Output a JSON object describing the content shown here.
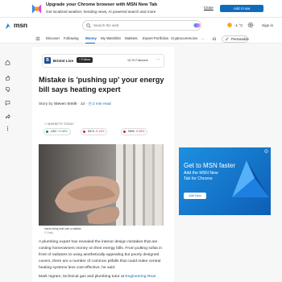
{
  "promo": {
    "title": "Upgrade your Chrome browser with MSN New Tab",
    "subtitle": "Get localized weather, trending news, AI powered search and more",
    "close_label": "Close",
    "add_label": "Add it now"
  },
  "header": {
    "logo_text": "msn",
    "search_placeholder": "Search the web",
    "weather_temp": "-1 °C",
    "signin_label": "Sign in"
  },
  "nav": {
    "items": [
      "Discover",
      "Following",
      "Money",
      "My Watchlist",
      "Markets",
      "Expert Portfolios",
      "Cryptocurrencies"
    ],
    "more_label": "...",
    "personalize_label": "Personalize"
  },
  "publisher": {
    "logo_letter": "B",
    "name": "Bristol Live",
    "follow_label": "+ Follow",
    "followers": "15.7K Followers",
    "more_label": "···"
  },
  "article": {
    "headline": "Mistake is 'pushing up' your energy bill says heating expert",
    "byline_prefix": "Story by ",
    "author": "Steven Smith",
    "time": " · 1d · ",
    "read_time": "2 min read",
    "markets_label": "MARKETS TODAY",
    "caption": "hands being held over a radiator",
    "credit": "© Getty",
    "body_p1": "A plumbing expert has revealed the interior design mistakes that are costing homeowners money on their energy bills. From putting sofas in front of radiators to using aesthetically-appealing but poorly designed covers, there are a number of common pitfalls that could make central heating systems less cost-effective, he said.",
    "body_p2_prefix": "Mark Ingram, technical gas and plumbing tutor at ",
    "body_p2_link": "Engineering Real"
  },
  "tickers": [
    {
      "name": "UKX",
      "change": "+0.08%",
      "dir": "up",
      "color": "#1a8a3b"
    },
    {
      "name": "MCX",
      "change": "-0.14%",
      "dir": "down",
      "color": "#c4262e"
    },
    {
      "name": "NMX",
      "change": "-0.26%",
      "dir": "down",
      "color": "#c4262e"
    }
  ],
  "ad": {
    "title": "Get to MSN faster",
    "subtitle": "Add the MSN New Tab for Chrome",
    "button_label": "Add Now"
  },
  "colors": {
    "accent": "#0f6cbd",
    "up": "#1a8a3b",
    "down": "#c4262e"
  }
}
